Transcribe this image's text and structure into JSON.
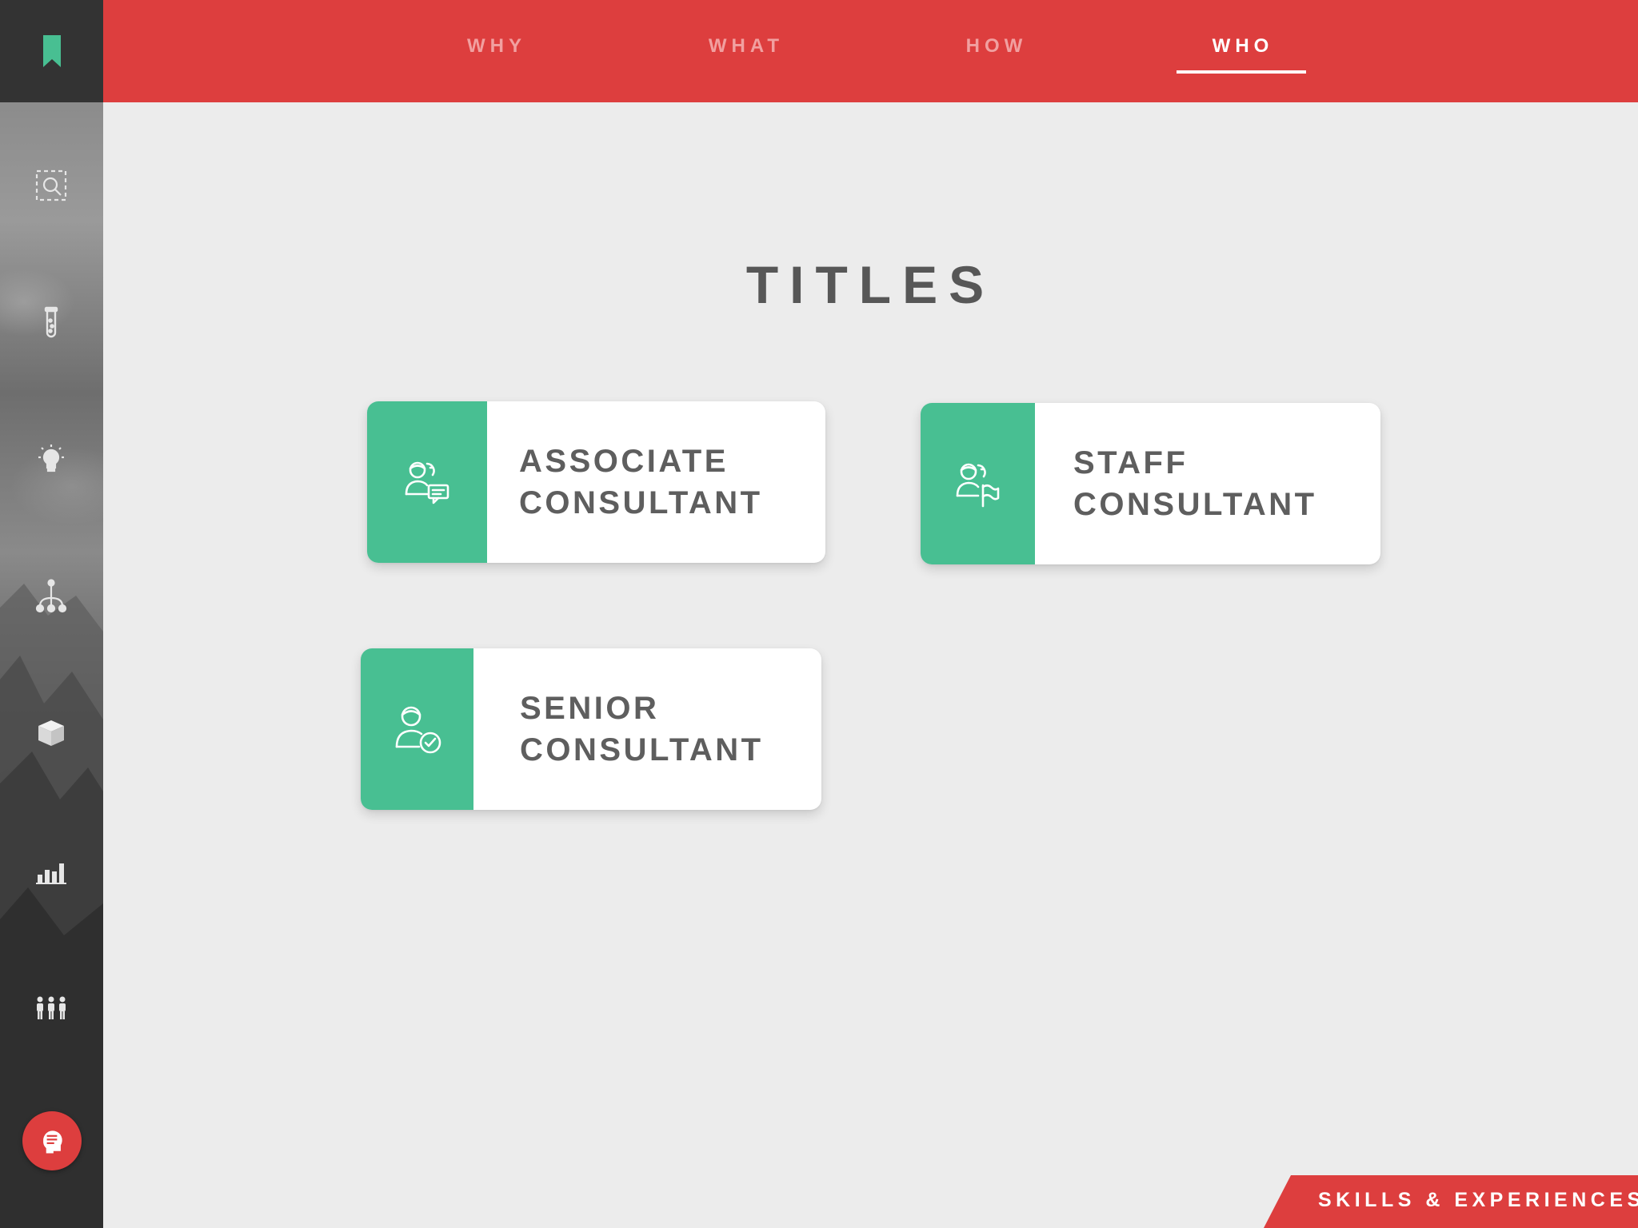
{
  "colors": {
    "accent_red": "#dd3e3e",
    "accent_green": "#48bf92",
    "sidebar_dark": "#333333",
    "text_gray": "#5e5e5e",
    "background": "#ececec"
  },
  "nav": {
    "items": [
      {
        "label": "WHY",
        "active": false
      },
      {
        "label": "WHAT",
        "active": false
      },
      {
        "label": "HOW",
        "active": false
      },
      {
        "label": "WHO",
        "active": true
      }
    ]
  },
  "sidebar": {
    "icons": [
      "search-frame-icon",
      "test-tube-icon",
      "lightbulb-icon",
      "hierarchy-icon",
      "cube-icon",
      "bar-chart-icon",
      "team-icon"
    ],
    "chat_icon": "chat-head-icon"
  },
  "main": {
    "title": "TITLES",
    "cards": [
      {
        "line1": "ASSOCIATE",
        "line2": "CONSULTANT",
        "icon": "people-chat-icon"
      },
      {
        "line1": "STAFF",
        "line2": "CONSULTANT",
        "icon": "people-flag-icon"
      },
      {
        "line1": "SENIOR",
        "line2": "CONSULTANT",
        "icon": "person-check-icon"
      }
    ]
  },
  "footer": {
    "tag_label": "SKILLS & EXPERIENCES"
  }
}
